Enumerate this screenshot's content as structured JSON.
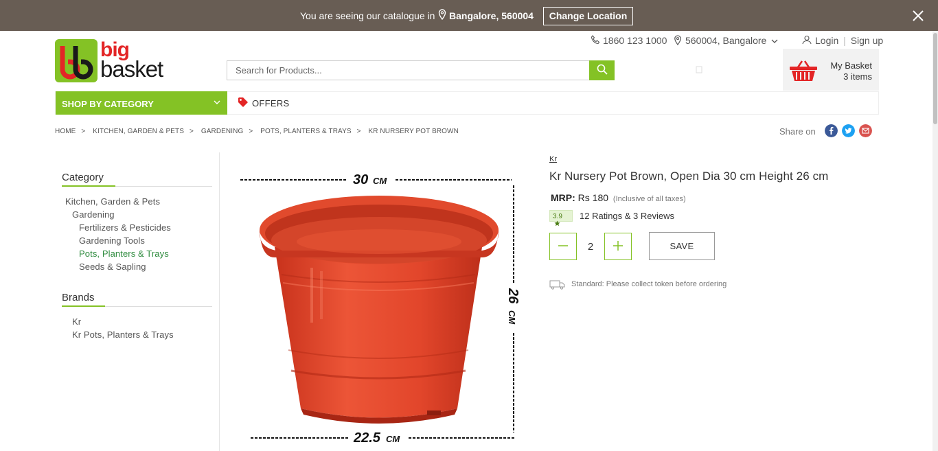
{
  "location_bar": {
    "text": "You are seeing our catalogue in",
    "city": "Bangalore, 560004",
    "change_label": "Change Location"
  },
  "header": {
    "logo_word1": "big",
    "logo_word2": "basket",
    "phone": "1860 123 1000",
    "location": "560004, Bangalore",
    "login": "Login",
    "signup": "Sign up",
    "search_placeholder": "Search for Products...",
    "basket_label": "My Basket",
    "basket_count": "3 items"
  },
  "nav": {
    "shop_by_category": "SHOP BY CATEGORY",
    "offers": "OFFERS"
  },
  "breadcrumb": [
    "HOME",
    "KITCHEN, GARDEN & PETS",
    "GARDENING",
    "POTS, PLANTERS & TRAYS",
    "KR NURSERY POT BROWN"
  ],
  "share_label": "Share on",
  "sidebar": {
    "category_heading": "Category",
    "categories": [
      "Kitchen, Garden & Pets",
      "Gardening",
      "Fertilizers & Pesticides",
      "Gardening Tools",
      "Pots, Planters & Trays",
      "Seeds & Sapling"
    ],
    "brands_heading": "Brands",
    "brands": [
      "Kr",
      "Kr Pots, Planters & Trays"
    ]
  },
  "product": {
    "brand": "Kr",
    "title": "Kr Nursery Pot Brown, Open Dia 30 cm Height 26 cm",
    "mrp_label": "MRP:",
    "price": "Rs 180",
    "tax_note": "(Inclusive of all taxes)",
    "rating": "3.9",
    "ratings_text": "12 Ratings & 3 Reviews",
    "quantity": "2",
    "save_label": "SAVE",
    "delivery": "Standard: Please collect token before ordering",
    "image_dims": {
      "top": "30",
      "top_unit": "CM",
      "height": "26",
      "height_unit": "CM",
      "bottom": "22.5",
      "bottom_unit": "CM"
    }
  },
  "colors": {
    "brand_green": "#84c225",
    "brand_red": "#e32526",
    "topbar": "#685d54",
    "pot": "#e0452b"
  }
}
